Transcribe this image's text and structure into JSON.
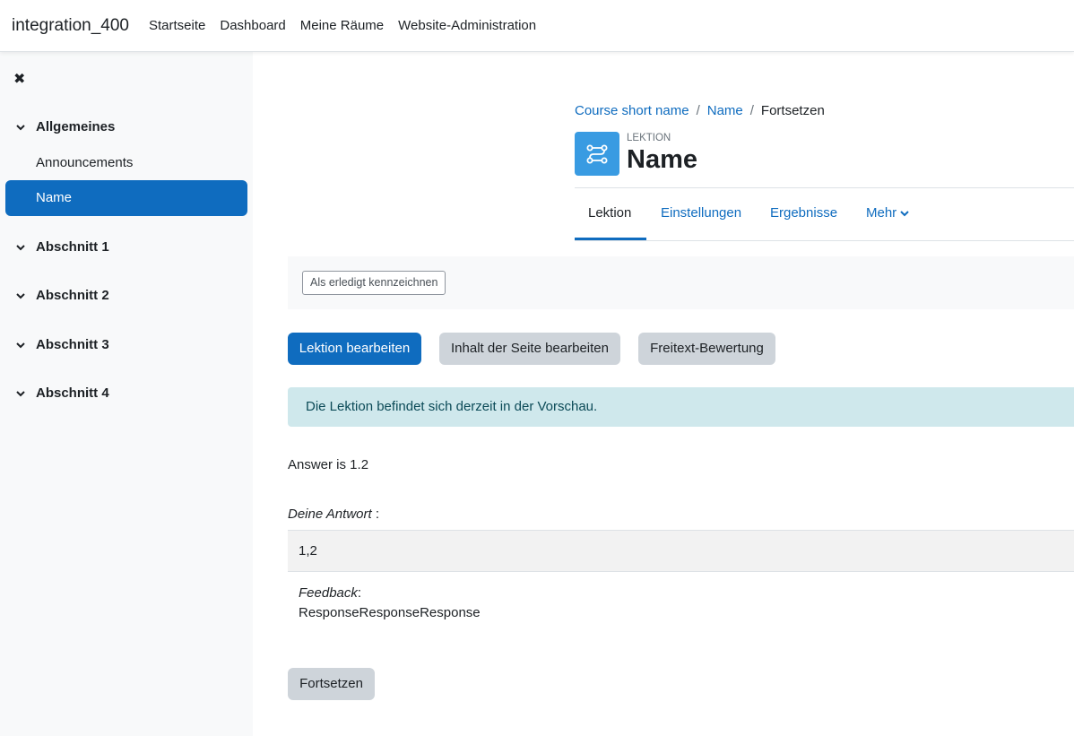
{
  "navbar": {
    "site_name": "integration_400",
    "links": [
      "Startseite",
      "Dashboard",
      "Meine Räume",
      "Website-Administration"
    ]
  },
  "drawer": {
    "close_glyph": "✖",
    "sections": [
      {
        "label": "Allgemeines",
        "items": [
          "Announcements",
          "Name"
        ],
        "active_item": "Name"
      },
      {
        "label": "Abschnitt 1"
      },
      {
        "label": "Abschnitt 2"
      },
      {
        "label": "Abschnitt 3"
      },
      {
        "label": "Abschnitt 4"
      }
    ]
  },
  "breadcrumb": {
    "items": [
      "Course short name",
      "Name",
      "Fortsetzen"
    ],
    "separator": "/"
  },
  "header": {
    "label": "LEKTION",
    "title": "Name",
    "icon": "lesson-icon",
    "icon_color": "#399be2"
  },
  "tabs": {
    "items": [
      "Lektion",
      "Einstellungen",
      "Ergebnisse",
      "Mehr"
    ],
    "active": "Lektion"
  },
  "completion": {
    "button_label": "Als erledigt kennzeichnen"
  },
  "actions": {
    "edit_lesson": "Lektion bearbeiten",
    "edit_page": "Inhalt der Seite bearbeiten",
    "essay_grading": "Freitext-Bewertung"
  },
  "alert": {
    "text": "Die Lektion befindet sich derzeit in der Vorschau."
  },
  "question": {
    "text": "Answer is 1.2",
    "answer_label": "Deine Antwort",
    "answer_suffix": " :",
    "answer_value": "1,2",
    "feedback_label": "Feedback",
    "feedback_suffix": ":",
    "feedback_text": "ResponseResponseResponse"
  },
  "continue_button": "Fortsetzen",
  "colors": {
    "primary": "#0f6cbf",
    "secondary": "#ced4da",
    "alert_bg": "#cfe8ec",
    "drawer_bg": "#f8f9fa"
  }
}
